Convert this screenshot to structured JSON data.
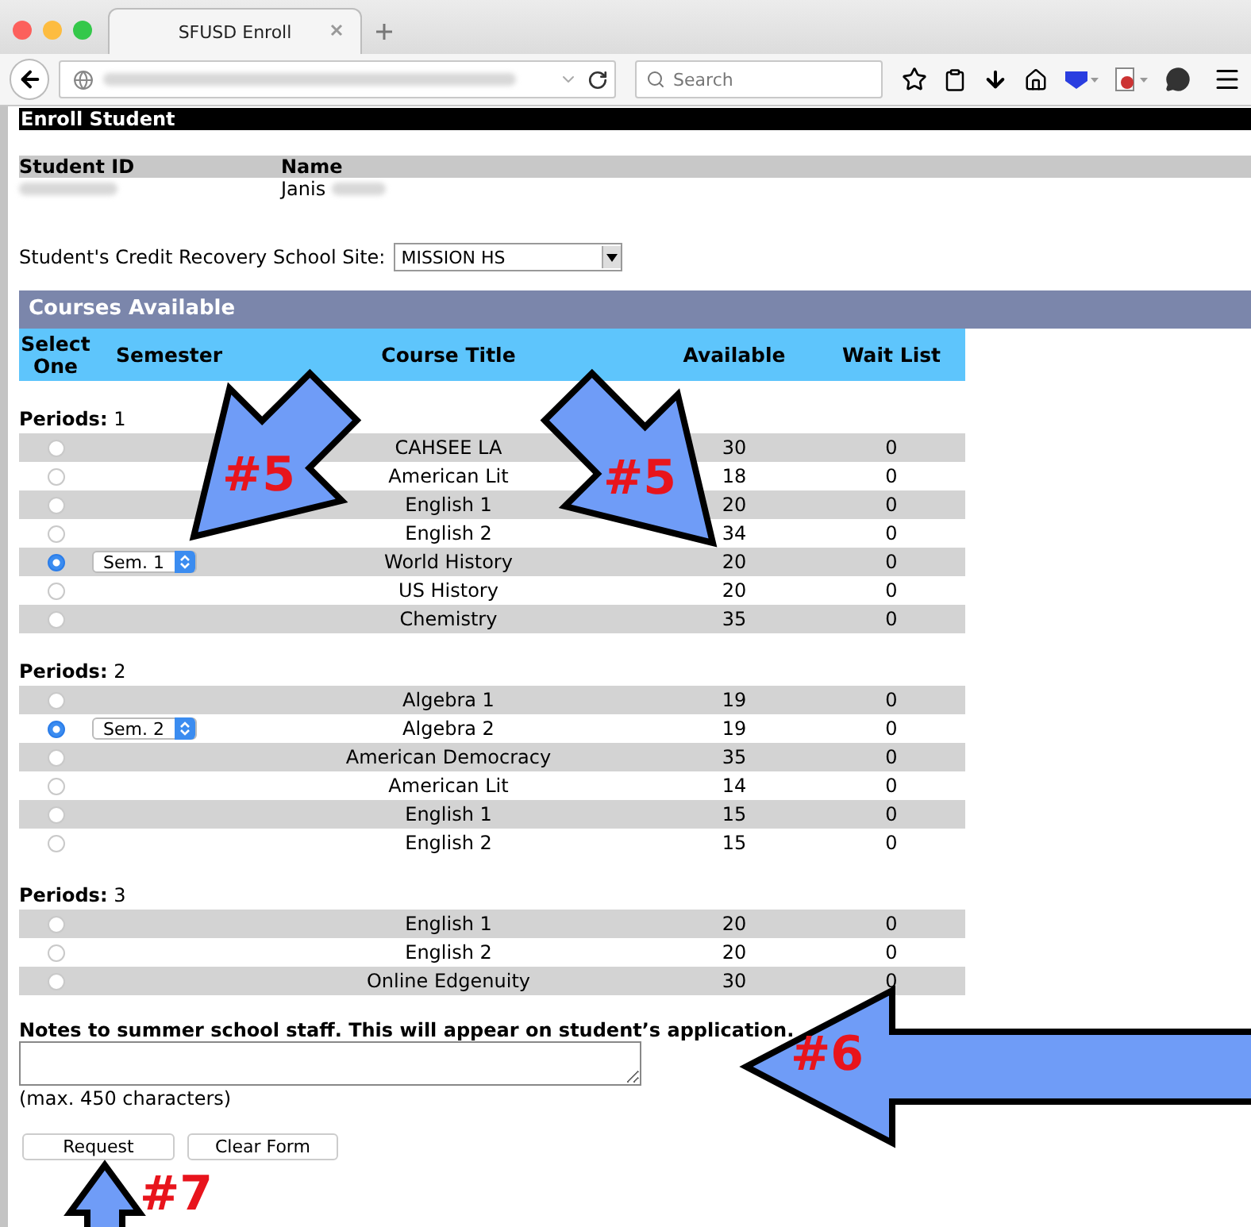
{
  "browser": {
    "tab": {
      "title": "SFUSD Enroll"
    },
    "search": {
      "placeholder": "Search"
    }
  },
  "page": {
    "title": "Enroll Student",
    "student": {
      "headers": [
        "Student ID",
        "Name"
      ],
      "name": "Janis"
    },
    "site": {
      "label": "Student's Credit Recovery School Site:",
      "value": "MISSION HS"
    },
    "courses_title": "Courses Available",
    "columns": [
      "Select One",
      "Semester",
      "Course Title",
      "Available",
      "Wait List"
    ],
    "periods": [
      {
        "label": "Periods:",
        "number": "1",
        "courses": [
          {
            "title": "CAHSEE LA",
            "available": "30",
            "wait_list": "0",
            "selected": false
          },
          {
            "title": "American Lit",
            "available": "18",
            "wait_list": "0",
            "selected": false
          },
          {
            "title": "English 1",
            "available": "20",
            "wait_list": "0",
            "selected": false
          },
          {
            "title": "English 2",
            "available": "34",
            "wait_list": "0",
            "selected": false
          },
          {
            "title": "World History",
            "available": "20",
            "wait_list": "0",
            "selected": true,
            "semester": "Sem. 1"
          },
          {
            "title": "US History",
            "available": "20",
            "wait_list": "0",
            "selected": false
          },
          {
            "title": "Chemistry",
            "available": "35",
            "wait_list": "0",
            "selected": false
          }
        ]
      },
      {
        "label": "Periods:",
        "number": "2",
        "courses": [
          {
            "title": "Algebra 1",
            "available": "19",
            "wait_list": "0",
            "selected": false
          },
          {
            "title": "Algebra 2",
            "available": "19",
            "wait_list": "0",
            "selected": true,
            "semester": "Sem. 2"
          },
          {
            "title": "American Democracy",
            "available": "35",
            "wait_list": "0",
            "selected": false
          },
          {
            "title": "American Lit",
            "available": "14",
            "wait_list": "0",
            "selected": false
          },
          {
            "title": "English 1",
            "available": "15",
            "wait_list": "0",
            "selected": false
          },
          {
            "title": "English 2",
            "available": "15",
            "wait_list": "0",
            "selected": false
          }
        ]
      },
      {
        "label": "Periods:",
        "number": "3",
        "courses": [
          {
            "title": "English 1",
            "available": "20",
            "wait_list": "0",
            "selected": false
          },
          {
            "title": "English 2",
            "available": "20",
            "wait_list": "0",
            "selected": false
          },
          {
            "title": "Online Edgenuity",
            "available": "30",
            "wait_list": "0",
            "selected": false
          }
        ]
      }
    ],
    "notes": {
      "label": "Notes to summer school staff. This will appear on student’s application.",
      "hint": "(max. 450 characters)"
    },
    "buttons": [
      "Request",
      "Clear Form"
    ]
  },
  "annotations": [
    {
      "label": "#5"
    },
    {
      "label": "#5"
    },
    {
      "label": "#6"
    },
    {
      "label": "#7"
    }
  ]
}
